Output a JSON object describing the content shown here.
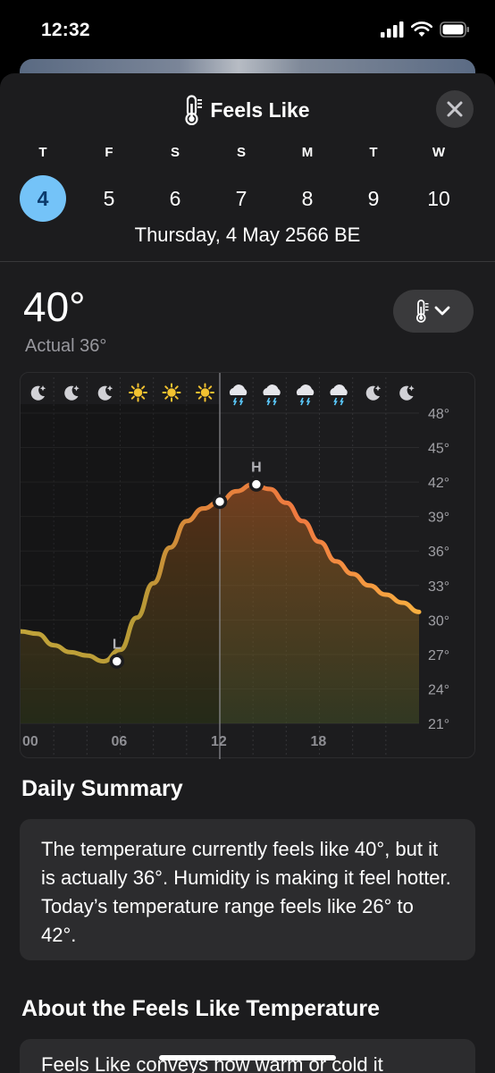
{
  "status_bar": {
    "time": "12:32"
  },
  "header": {
    "title": "Feels Like",
    "title_icon": "thermometer-icon",
    "close_icon": "close-icon"
  },
  "week": {
    "days": [
      {
        "letter": "T",
        "num": "4",
        "selected": true
      },
      {
        "letter": "F",
        "num": "5",
        "selected": false
      },
      {
        "letter": "S",
        "num": "6",
        "selected": false
      },
      {
        "letter": "S",
        "num": "7",
        "selected": false
      },
      {
        "letter": "M",
        "num": "8",
        "selected": false
      },
      {
        "letter": "T",
        "num": "9",
        "selected": false
      },
      {
        "letter": "W",
        "num": "10",
        "selected": false
      }
    ],
    "selected_date": "Thursday, 4 May 2566 BE"
  },
  "current": {
    "feels_like": "40°",
    "actual": "Actual 36°"
  },
  "colors": {
    "accent_selected": "#74c3f8",
    "line_cool": "#c2a43a",
    "line_hot": "#f07a40",
    "line_end": "#f8b040",
    "sheet_bg": "#1c1c1e",
    "card_bg": "#2c2c2e"
  },
  "chart_data": {
    "type": "line",
    "x_tick_labels": [
      "00",
      "06",
      "12",
      "18"
    ],
    "y_tick_labels": [
      "48°",
      "45°",
      "42°",
      "39°",
      "36°",
      "33°",
      "30°",
      "27°",
      "24°",
      "21°"
    ],
    "ylim": [
      21,
      48
    ],
    "xlim": [
      0,
      24
    ],
    "hours": [
      0,
      1,
      2,
      3,
      4,
      5,
      6,
      7,
      8,
      9,
      10,
      11,
      12,
      13,
      14,
      15,
      16,
      17,
      18,
      19,
      20,
      21,
      22,
      23,
      24
    ],
    "values": [
      29,
      28.8,
      27.8,
      27.2,
      26.9,
      26.4,
      27.4,
      30.2,
      33.2,
      36.3,
      38.6,
      39.7,
      40.3,
      41.2,
      41.8,
      41.4,
      40.2,
      38.6,
      36.8,
      35.1,
      34,
      33,
      32.2,
      31.5,
      30.7
    ],
    "current_hour": 12,
    "low": {
      "label": "L",
      "hour": 5.8,
      "value": 26.4
    },
    "high": {
      "label": "H",
      "hour": 14.2,
      "value": 41.8
    },
    "hourly_icons": [
      "moon-icon",
      "moon-icon",
      "moon-icon",
      "sun-icon",
      "sun-icon",
      "sun-icon",
      "thunderstorm-icon",
      "thunderstorm-icon",
      "thunderstorm-icon",
      "thunderstorm-icon",
      "moon-icon",
      "moon-icon"
    ],
    "grid": true
  },
  "summary": {
    "title": "Daily Summary",
    "text": "The temperature currently feels like 40°, but it is actually 36°. Humidity is making it feel hotter. Today’s temperature range feels like 26° to 42°."
  },
  "about": {
    "title": "About the Feels Like Temperature",
    "text": "Feels Like conveys how warm or cold it"
  }
}
